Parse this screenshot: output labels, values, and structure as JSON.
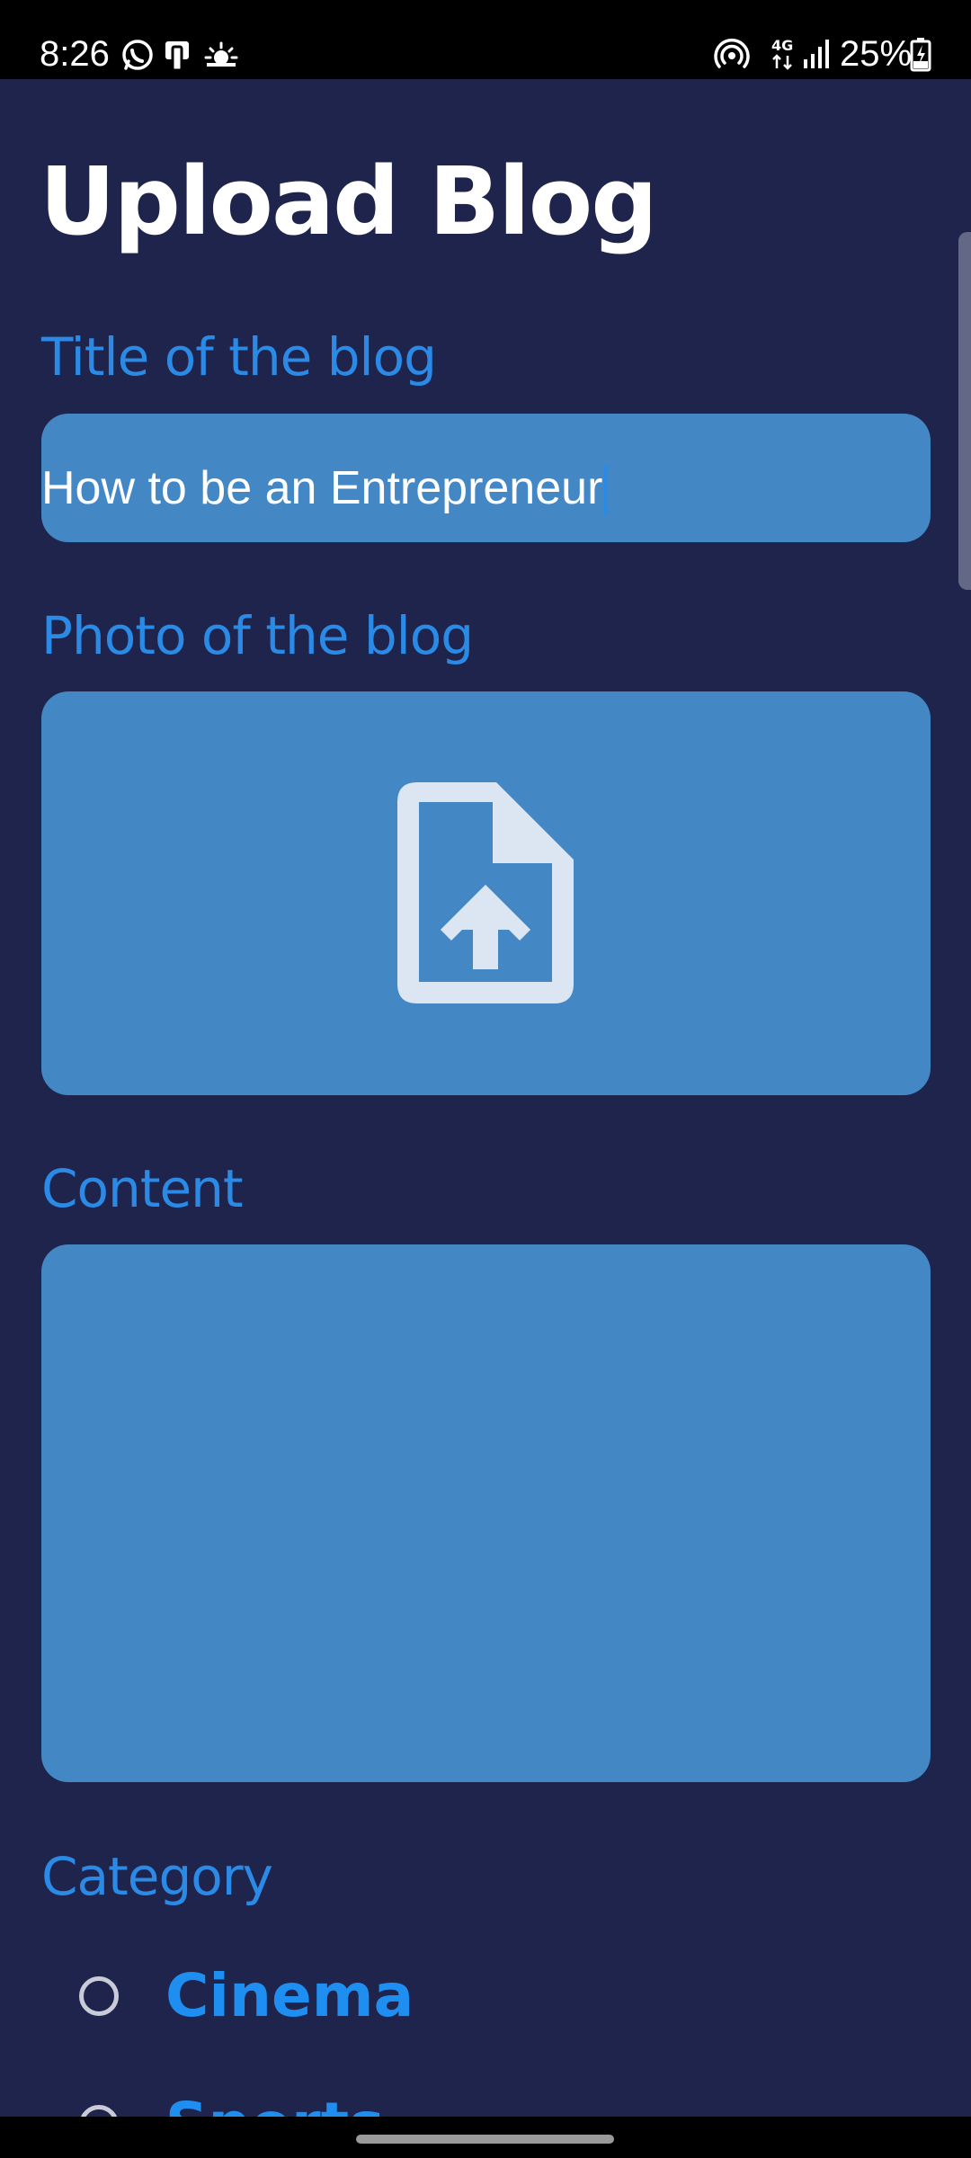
{
  "status_bar": {
    "time": "8:26",
    "icons": [
      "whatsapp-icon",
      "sim-card-icon",
      "weather-icon",
      "hotspot-icon",
      "network-4g-icon",
      "signal-icon",
      "battery-charging-icon"
    ],
    "network_label": "4G",
    "battery": "25%"
  },
  "page": {
    "title": "Upload Blog"
  },
  "form": {
    "title_label": "Title of the blog",
    "title_value": "How to be an Entrepreneur",
    "photo_label": "Photo of the blog",
    "photo_icon": "file-upload-icon",
    "content_label": "Content",
    "content_value": "",
    "category_label": "Category",
    "categories": [
      {
        "label": "Cinema",
        "selected": false
      },
      {
        "label": "Sports",
        "selected": false
      }
    ]
  },
  "colors": {
    "background": "#1e244b",
    "field_background": "#4487c5",
    "label_accent": "#2a8ae6",
    "category_text": "#1e8ef0",
    "title_text": "#ffffff"
  }
}
